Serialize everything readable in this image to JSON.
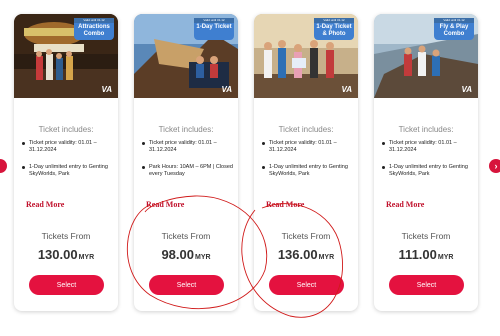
{
  "accent_color": "#e4123f",
  "ribbon_color": "#3f7fd0",
  "includes_title": "Ticket includes:",
  "read_more_label": "Read More",
  "tickets_from_label": "Tickets From",
  "select_label": "Select",
  "currency": "MYR",
  "nav": {
    "prev_icon": "chevron-left-icon",
    "next_icon": "chevron-right-icon",
    "next_glyph": "›"
  },
  "cards": [
    {
      "ribbon_tag": "Valid until 31.12",
      "ribbon_text": "Attractions Combo",
      "logo": "VA",
      "bullets": [
        "Ticket price validity: 01.01 – 31.12.2024",
        "1-Day unlimited entry to Genting SkyWorlds, Park"
      ],
      "price": "130.00"
    },
    {
      "ribbon_tag": "Valid until 31.12",
      "ribbon_text": "1-Day Ticket",
      "logo": "VA",
      "bullets": [
        "Ticket price validity: 01.01 – 31.12.2024",
        "Park Hours: 10AM – 6PM | Closed every Tuesday"
      ],
      "price": "98.00"
    },
    {
      "ribbon_tag": "Valid until 31.12",
      "ribbon_text": "1-Day Ticket & Photo",
      "logo": "VA",
      "bullets": [
        "Ticket price validity: 01.01 – 31.12.2024",
        "1-Day unlimited entry to Genting SkyWorlds, Park"
      ],
      "price": "136.00"
    },
    {
      "ribbon_tag": "Valid until 31.12",
      "ribbon_text": "Fly & Play Combo",
      "logo": "VA",
      "bullets": [
        "Ticket price validity: 01.01 – 31.12.2024",
        "1-Day unlimited entry to Genting SkyWorlds, Park"
      ],
      "price": "111.00"
    }
  ]
}
